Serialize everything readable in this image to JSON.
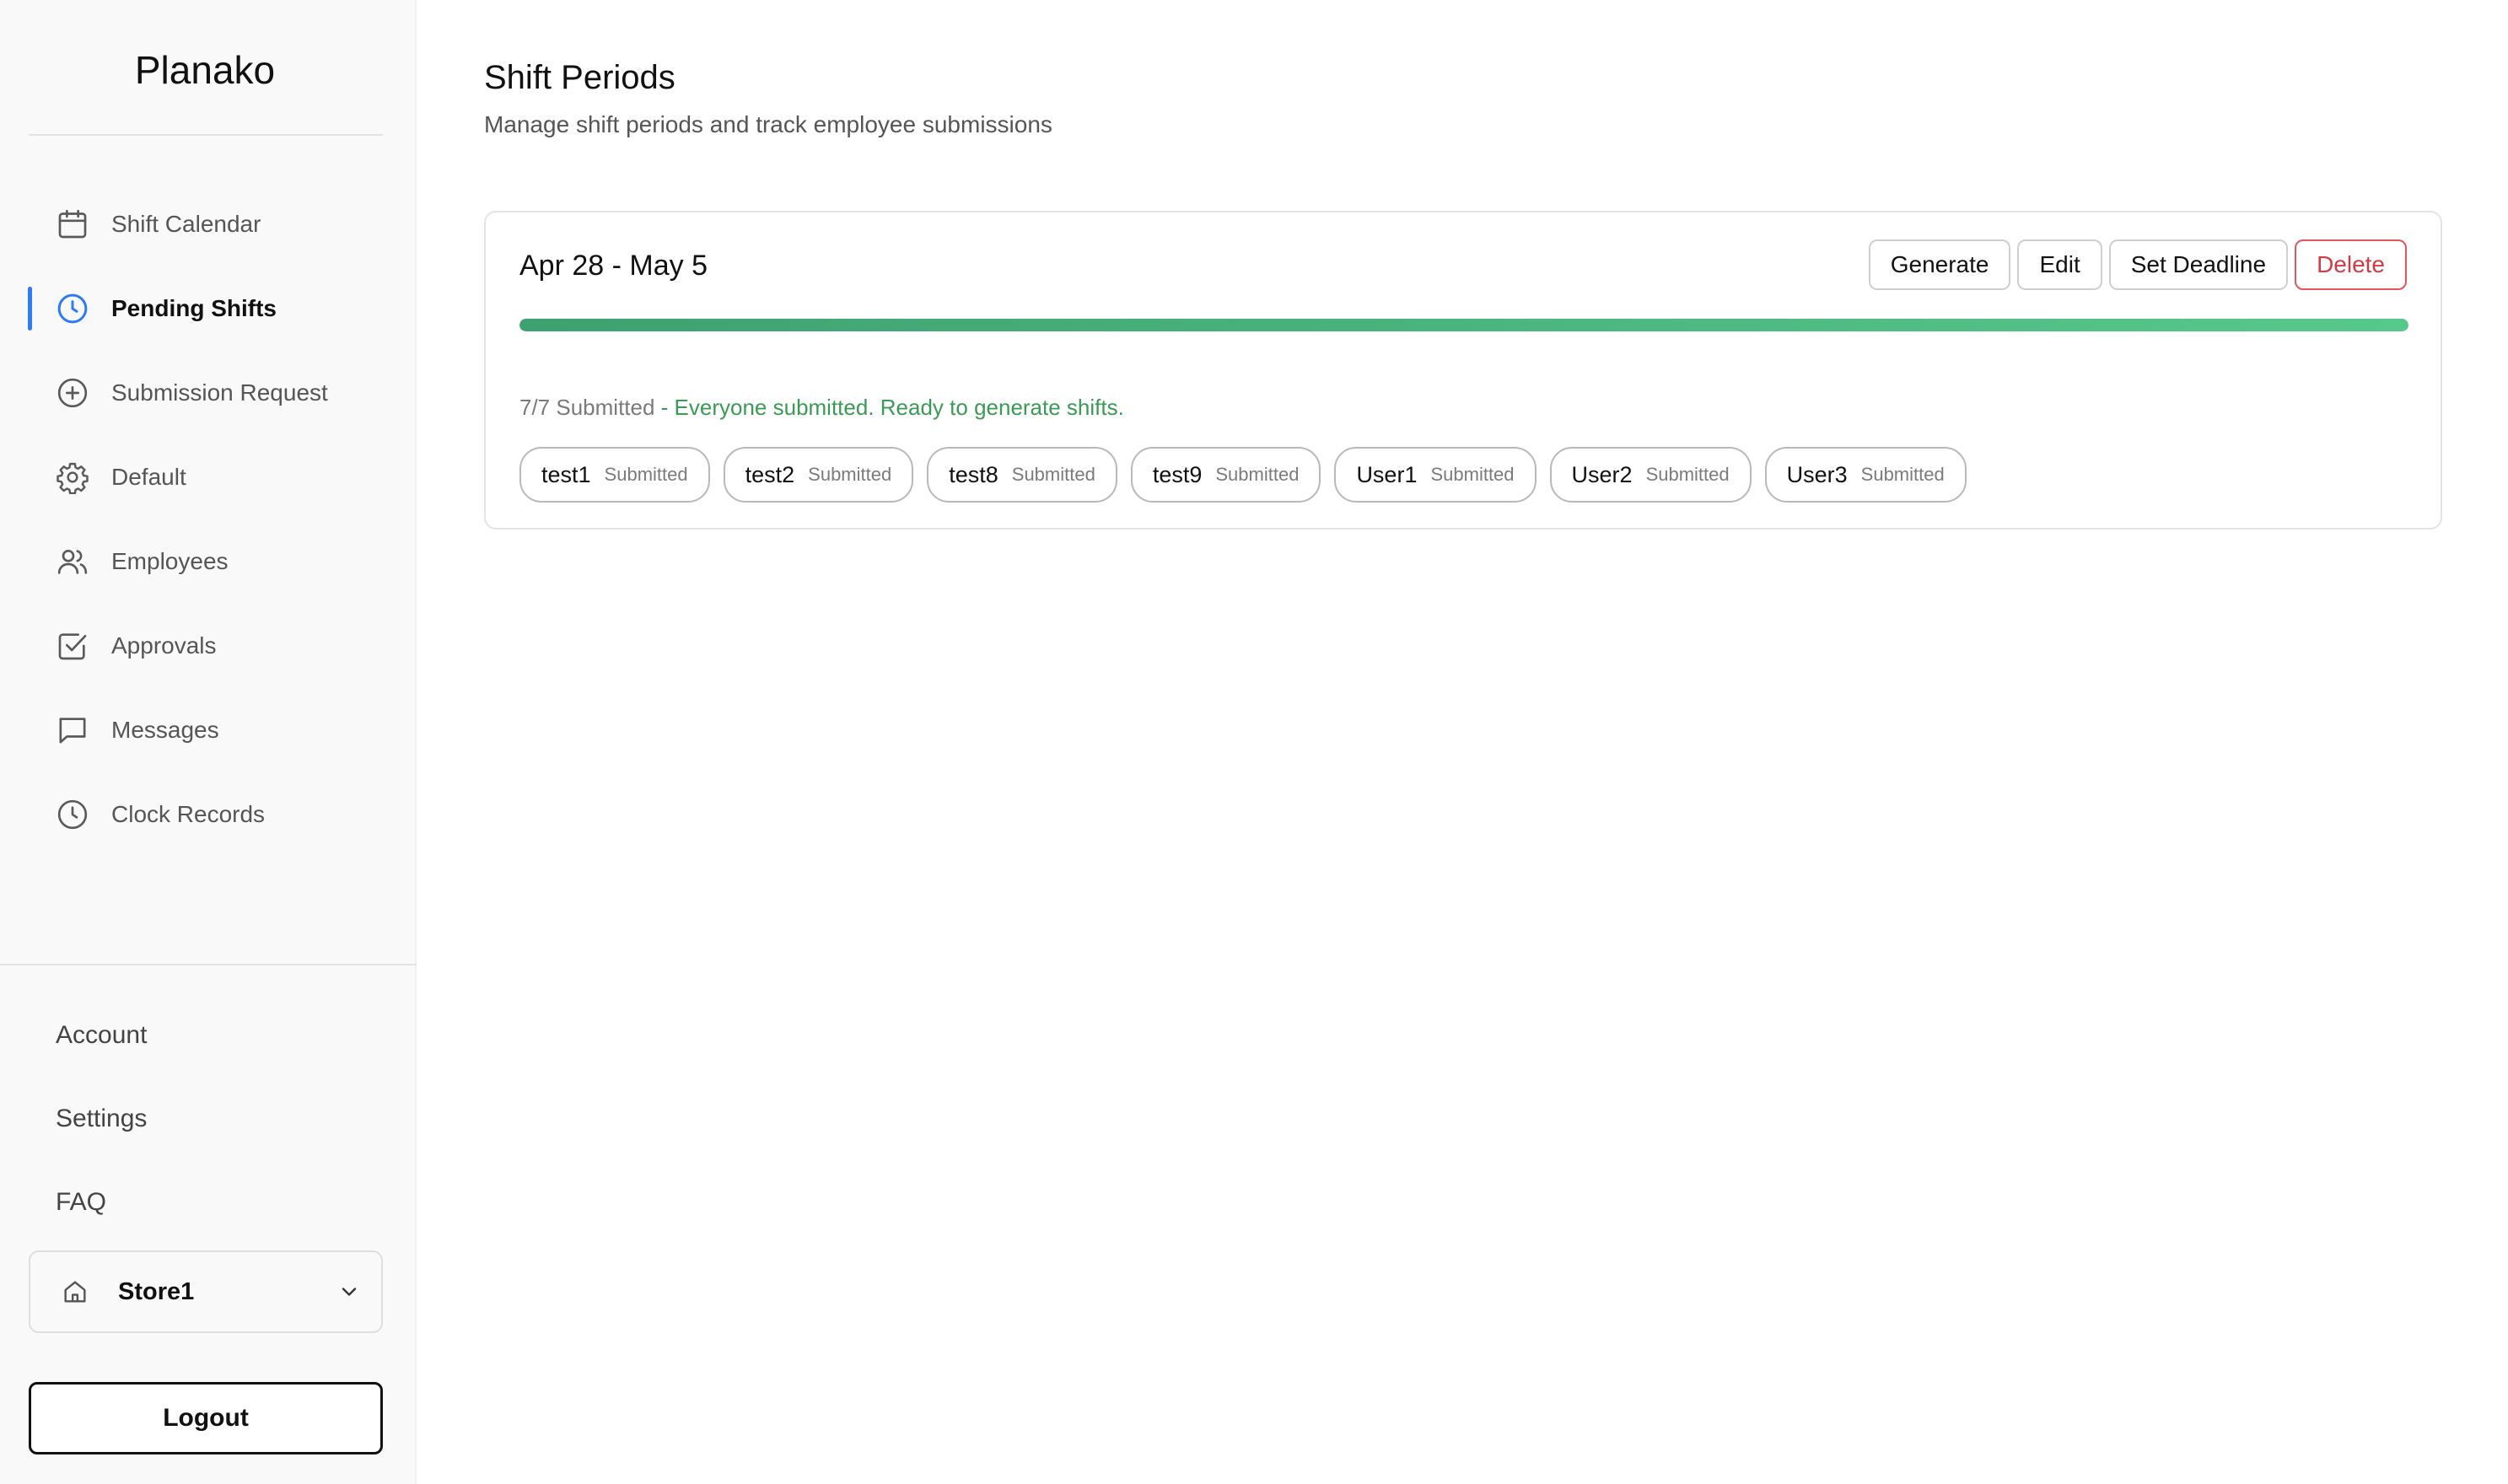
{
  "app": {
    "name": "Planako"
  },
  "sidebar": {
    "nav": [
      {
        "label": "Shift Calendar",
        "icon": "calendar-icon",
        "active": false
      },
      {
        "label": "Pending Shifts",
        "icon": "clock-icon",
        "active": true
      },
      {
        "label": "Submission Request",
        "icon": "plus-circle-icon",
        "active": false
      },
      {
        "label": "Default",
        "icon": "gear-icon",
        "active": false
      },
      {
        "label": "Employees",
        "icon": "users-icon",
        "active": false
      },
      {
        "label": "Approvals",
        "icon": "checkbox-icon",
        "active": false
      },
      {
        "label": "Messages",
        "icon": "message-icon",
        "active": false
      },
      {
        "label": "Clock Records",
        "icon": "clock-icon",
        "active": false
      }
    ],
    "account_label": "Account",
    "settings_label": "Settings",
    "faq_label": "FAQ",
    "store": {
      "name": "Store1",
      "icon": "home-icon"
    },
    "logout_label": "Logout"
  },
  "main": {
    "title": "Shift Periods",
    "subtitle": "Manage shift periods and track employee submissions",
    "period": {
      "title": "Apr 28 - May 5",
      "buttons": {
        "generate": "Generate",
        "edit": "Edit",
        "set_deadline": "Set Deadline",
        "delete": "Delete"
      },
      "progress": 1.0,
      "status_count": "7/7 Submitted",
      "status_message": " - Everyone submitted. Ready to generate shifts.",
      "employees": [
        {
          "name": "test1",
          "status": "Submitted"
        },
        {
          "name": "test2",
          "status": "Submitted"
        },
        {
          "name": "test8",
          "status": "Submitted"
        },
        {
          "name": "test9",
          "status": "Submitted"
        },
        {
          "name": "User1",
          "status": "Submitted"
        },
        {
          "name": "User2",
          "status": "Submitted"
        },
        {
          "name": "User3",
          "status": "Submitted"
        }
      ]
    }
  },
  "colors": {
    "accent": "#2f7bf5",
    "success": "#3b9a55",
    "progress": "#4cb87c",
    "danger": "#d23a44"
  }
}
